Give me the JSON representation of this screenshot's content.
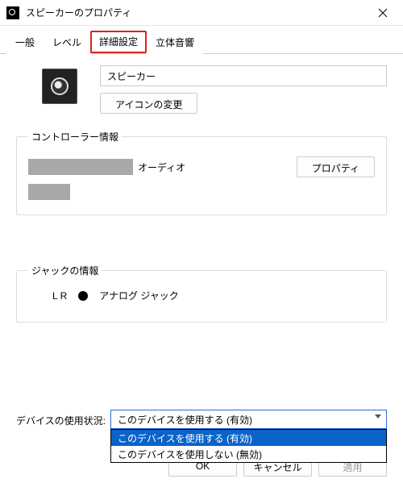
{
  "window": {
    "title": "スピーカーのプロパティ"
  },
  "tabs": {
    "general": "一般",
    "level": "レベル",
    "advanced": "詳細設定",
    "spatial": "立体音響"
  },
  "general": {
    "device_name": "スピーカー",
    "change_icon": "アイコンの変更"
  },
  "controller": {
    "legend": "コントローラー情報",
    "suffix": "オーディオ",
    "properties_btn": "プロパティ"
  },
  "jack": {
    "legend": "ジャックの情報",
    "lr": "L R",
    "type": "アナログ ジャック"
  },
  "usage": {
    "label": "デバイスの使用状況:",
    "selected": "このデバイスを使用する (有効)",
    "options": {
      "enable": "このデバイスを使用する (有効)",
      "disable": "このデバイスを使用しない (無効)"
    }
  },
  "footer": {
    "ok": "OK",
    "cancel": "キャンセル",
    "apply": "適用"
  }
}
